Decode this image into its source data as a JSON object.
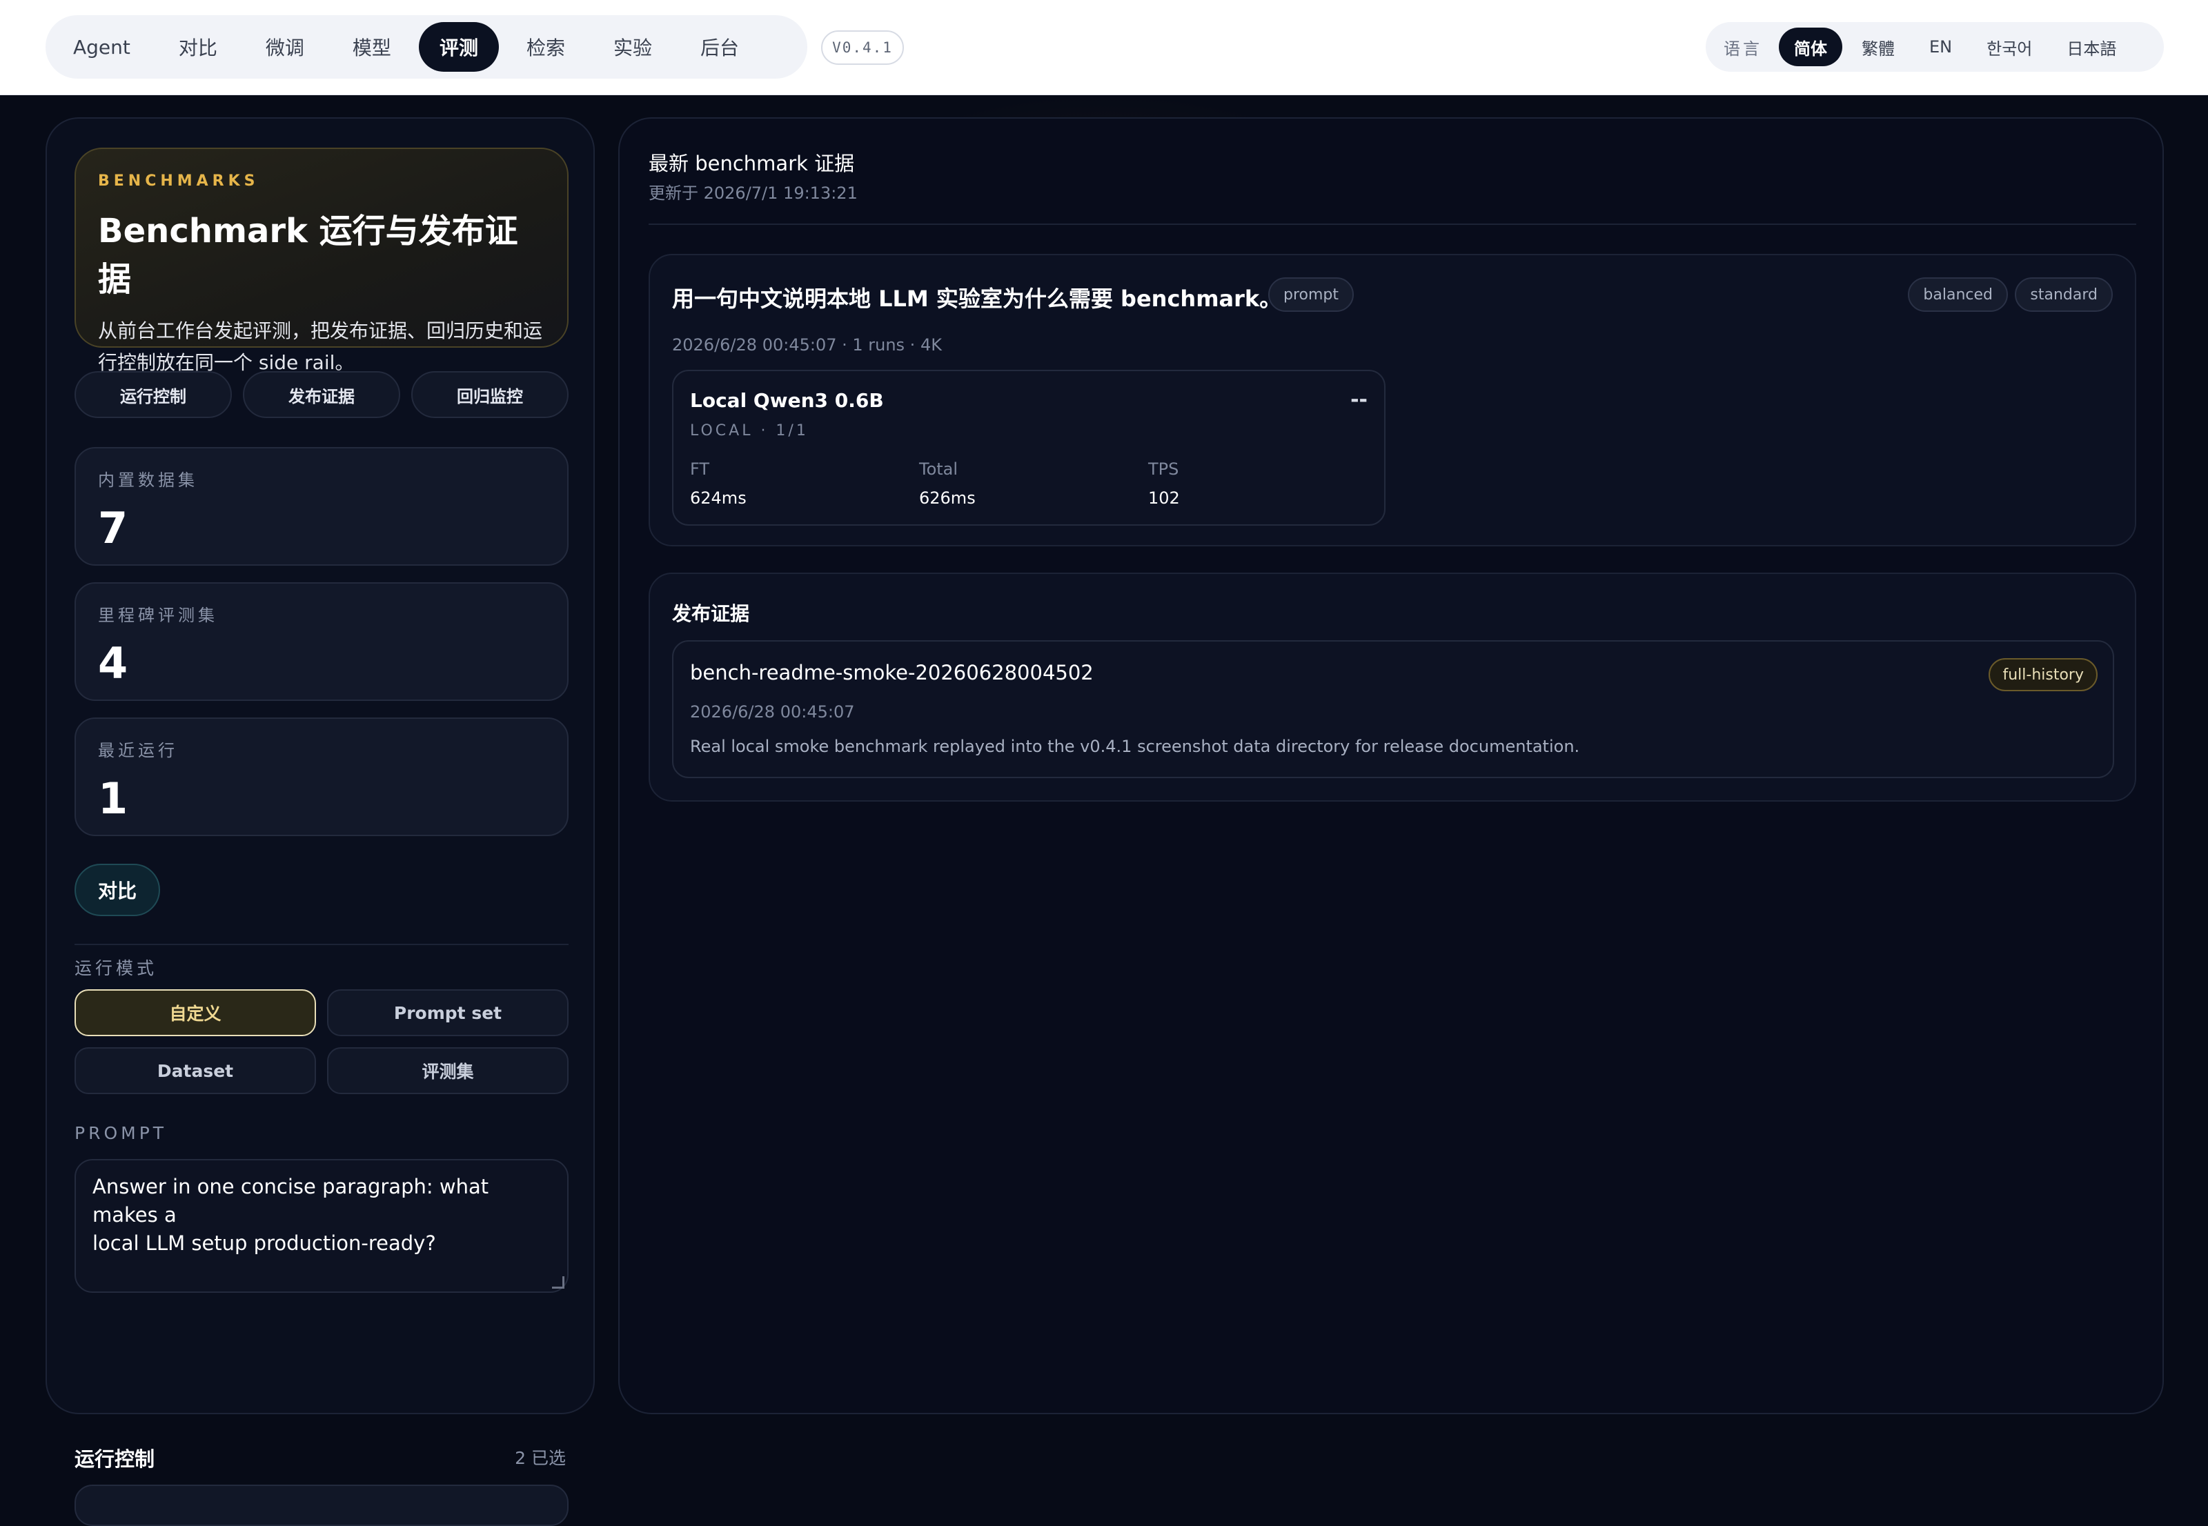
{
  "nav": {
    "items": [
      {
        "label": "Agent"
      },
      {
        "label": "对比"
      },
      {
        "label": "微调"
      },
      {
        "label": "模型"
      },
      {
        "label": "评测"
      },
      {
        "label": "检索"
      },
      {
        "label": "实验"
      },
      {
        "label": "后台"
      }
    ],
    "active_index": 4,
    "version": "V0.4.1"
  },
  "language": {
    "label": "语言",
    "options": [
      "简体",
      "繁體",
      "EN",
      "한국어",
      "日本語"
    ],
    "active": "简体"
  },
  "hero": {
    "eyebrow": "BENCHMARKS",
    "title": "Benchmark 运行与发布证据",
    "description_line1": "从前台工作台发起评测，把发布证据、回归历史和运",
    "description_line2": "行控制放在同一个 side rail。"
  },
  "side_tabs": [
    "运行控制",
    "发布证据",
    "回归监控"
  ],
  "stats": [
    {
      "label": "内置数据集",
      "value": "7"
    },
    {
      "label": "里程碑评测集",
      "value": "4"
    },
    {
      "label": "最近运行",
      "value": "1"
    }
  ],
  "compare_button": "对比",
  "run_mode": {
    "label": "运行模式",
    "options": [
      "自定义",
      "Prompt set",
      "Dataset",
      "评测集"
    ],
    "active": "自定义"
  },
  "prompt": {
    "label": "PROMPT",
    "value_line1": "Answer in one concise paragraph: what makes a",
    "value_line2": "local LLM setup production-ready?"
  },
  "run_control": {
    "title": "运行控制",
    "count": "2 已选"
  },
  "latest": {
    "title": "最新 benchmark 证据",
    "updated": "更新于 2026/7/1 19:13:21"
  },
  "question_card": {
    "title": "用一句中文说明本地 LLM 实验室为什么需要 benchmark。",
    "type_tag": "prompt",
    "tags": [
      "balanced",
      "standard"
    ],
    "meta": "2026/6/28 00:45:07 · 1 runs · 4K",
    "model": {
      "name": "Local Qwen3 0.6B",
      "status": "--",
      "sub": "LOCAL · 1/1",
      "metrics": [
        {
          "label": "FT",
          "value": "624ms"
        },
        {
          "label": "Total",
          "value": "626ms"
        },
        {
          "label": "TPS",
          "value": "102"
        }
      ]
    }
  },
  "release_evidence": {
    "title": "发布证据",
    "item": {
      "name": "bench-readme-smoke-20260628004502",
      "tag": "full-history",
      "date": "2026/6/28 00:45:07",
      "description": "Real local smoke benchmark replayed into the v0.4.1 screenshot data directory for release documentation."
    }
  }
}
